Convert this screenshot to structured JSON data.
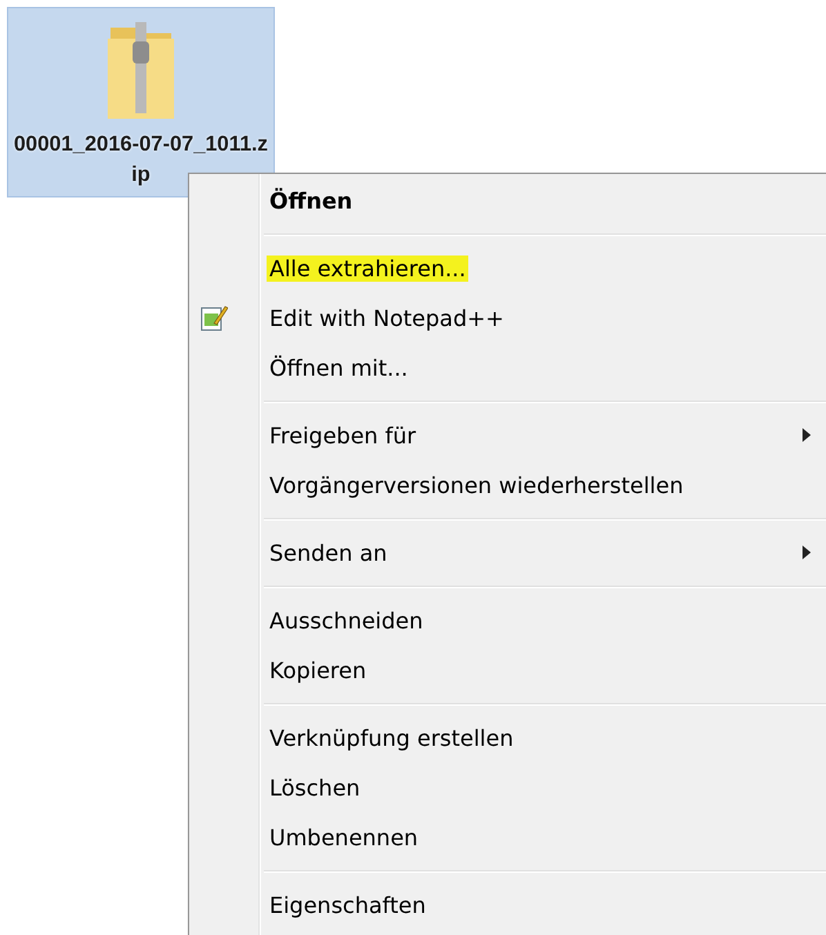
{
  "desktop_icon": {
    "label": "00001_2016-07-07_1011.zip",
    "selected": true
  },
  "context_menu": {
    "items": [
      {
        "kind": "item",
        "label": "Öffnen",
        "bold": true,
        "highlighted": false,
        "submenu": false,
        "has_icon": false
      },
      {
        "kind": "separator"
      },
      {
        "kind": "item",
        "label": "Alle extrahieren...",
        "bold": false,
        "highlighted": true,
        "submenu": false,
        "has_icon": false
      },
      {
        "kind": "item",
        "label": "Edit with Notepad++",
        "bold": false,
        "highlighted": false,
        "submenu": false,
        "has_icon": true
      },
      {
        "kind": "item",
        "label": "Öffnen mit...",
        "bold": false,
        "highlighted": false,
        "submenu": false,
        "has_icon": false
      },
      {
        "kind": "separator"
      },
      {
        "kind": "item",
        "label": "Freigeben für",
        "bold": false,
        "highlighted": false,
        "submenu": true,
        "has_icon": false
      },
      {
        "kind": "item",
        "label": "Vorgängerversionen wiederherstellen",
        "bold": false,
        "highlighted": false,
        "submenu": false,
        "has_icon": false
      },
      {
        "kind": "separator"
      },
      {
        "kind": "item",
        "label": "Senden an",
        "bold": false,
        "highlighted": false,
        "submenu": true,
        "has_icon": false
      },
      {
        "kind": "separator"
      },
      {
        "kind": "item",
        "label": "Ausschneiden",
        "bold": false,
        "highlighted": false,
        "submenu": false,
        "has_icon": false
      },
      {
        "kind": "item",
        "label": "Kopieren",
        "bold": false,
        "highlighted": false,
        "submenu": false,
        "has_icon": false
      },
      {
        "kind": "separator"
      },
      {
        "kind": "item",
        "label": "Verknüpfung erstellen",
        "bold": false,
        "highlighted": false,
        "submenu": false,
        "has_icon": false
      },
      {
        "kind": "item",
        "label": "Löschen",
        "bold": false,
        "highlighted": false,
        "submenu": false,
        "has_icon": false
      },
      {
        "kind": "item",
        "label": "Umbenennen",
        "bold": false,
        "highlighted": false,
        "submenu": false,
        "has_icon": false
      },
      {
        "kind": "separator"
      },
      {
        "kind": "item",
        "label": "Eigenschaften",
        "bold": false,
        "highlighted": false,
        "submenu": false,
        "has_icon": false
      }
    ]
  }
}
